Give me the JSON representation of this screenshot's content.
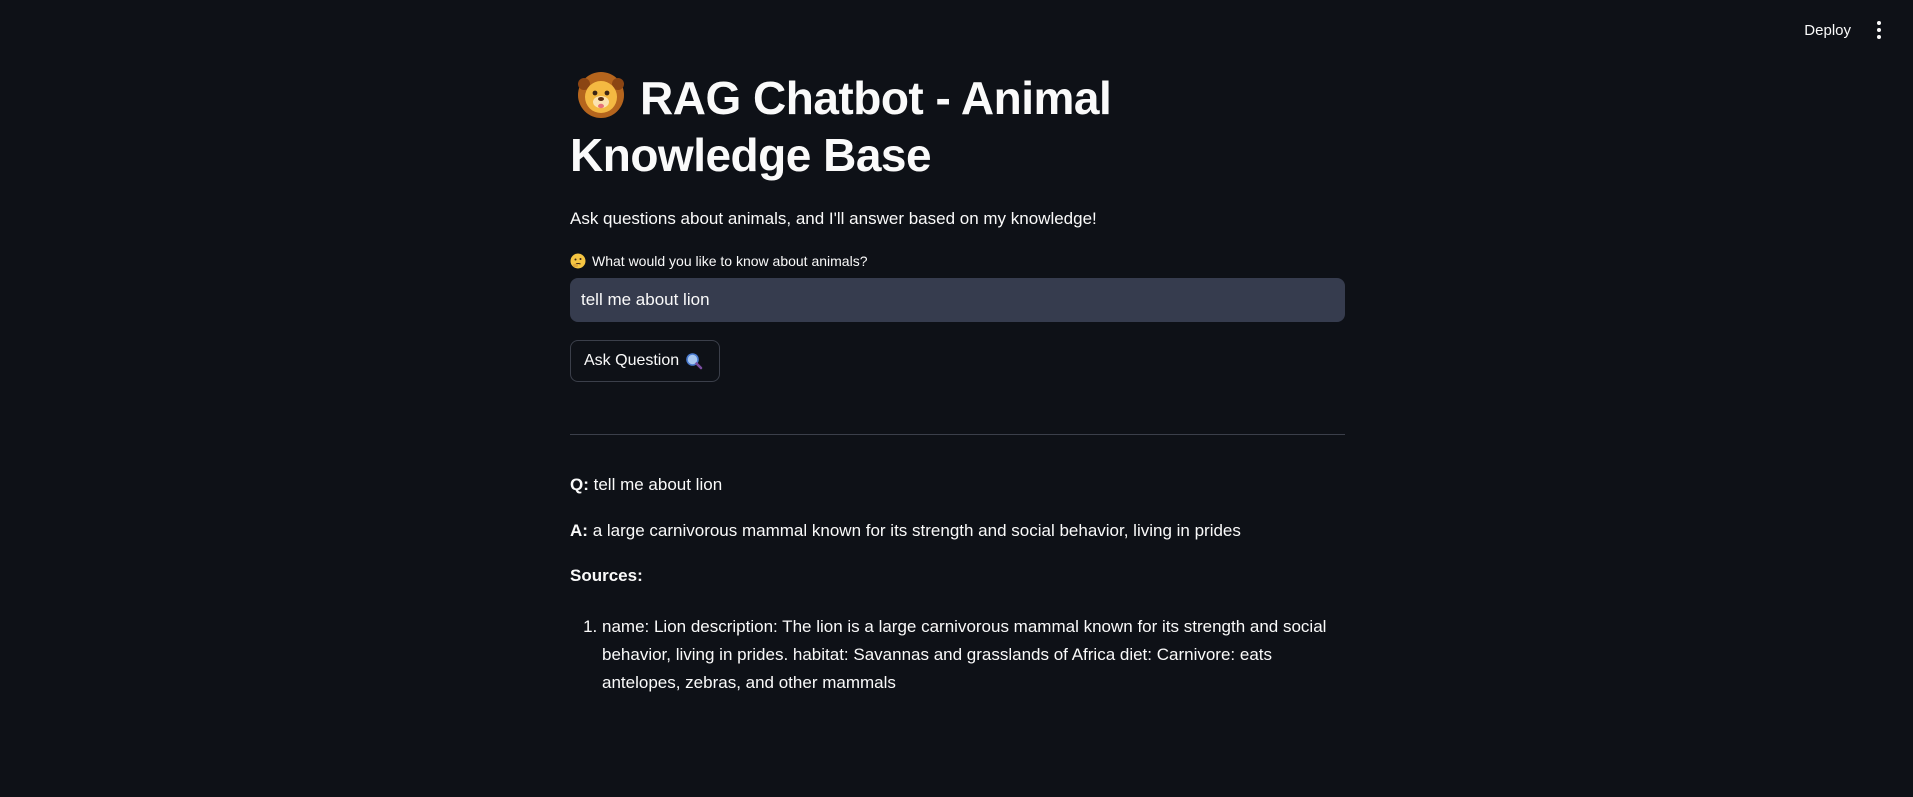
{
  "header": {
    "deploy_label": "Deploy",
    "menu_icon": "more-vertical-icon"
  },
  "page": {
    "title_emoji": "lion-face-icon",
    "title": "RAG Chatbot - Animal Knowledge Base",
    "subtitle": "Ask questions about animals, and I'll answer based on my knowledge!"
  },
  "query": {
    "label_emoji": "thinking-face-icon",
    "label": "What would you like to know about animals?",
    "value": "tell me about lion",
    "button_label": "Ask Question",
    "button_icon": "magnifying-glass-icon"
  },
  "result": {
    "q_prefix": "Q:",
    "question": "tell me about lion",
    "a_prefix": "A:",
    "answer": "a large carnivorous mammal known for its strength and social behavior, living in prides",
    "sources_label": "Sources:",
    "sources": [
      "name: Lion description: The lion is a large carnivorous mammal known for its strength and social behavior, living in prides. habitat: Savannas and grasslands of Africa diet: Carnivore: eats antelopes, zebras, and other mammals"
    ]
  }
}
